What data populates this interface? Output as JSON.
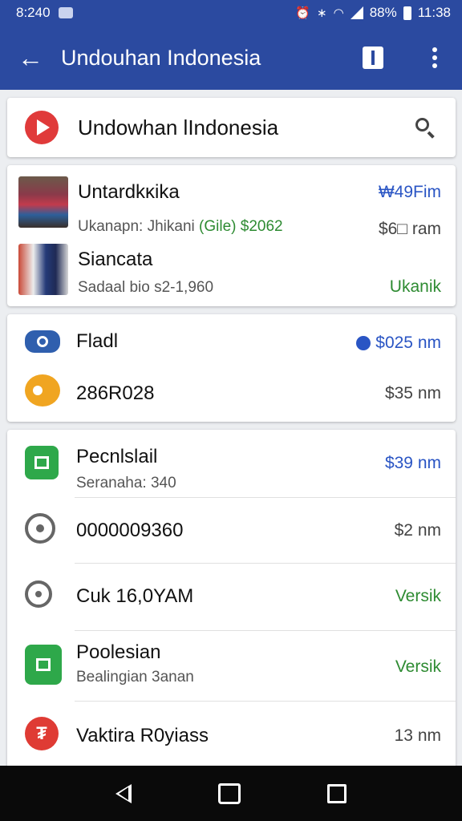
{
  "status_bar": {
    "time_left": "8:240",
    "battery_pct": "88%",
    "time_right": "11:38"
  },
  "app_bar": {
    "title": "Undouhan Indonesia"
  },
  "search": {
    "title": "Undowhan lIndonesia"
  },
  "group1": [
    {
      "title": "Untardkĸika",
      "subtitle": "Ukanapn: Jhikani",
      "tag": "(Gile)",
      "tag_amount": "$2062",
      "value_top": "₩49Fim",
      "value_bottom": "$6□ ram"
    },
    {
      "title": "Siancata",
      "subtitle": "Sadaal bio s2-1,960",
      "value": "Ukanik"
    }
  ],
  "group2": [
    {
      "title": "Fladl",
      "value": "$025 nm"
    },
    {
      "title": "286R028",
      "value": "$35 nm"
    }
  ],
  "group3": [
    {
      "title": "Pecnlslail",
      "subtitle": "Seranaha: 340",
      "value": "$39 nm"
    },
    {
      "title": "0000009360",
      "value": "$2 nm"
    },
    {
      "title": "Cuk 16,0YAM",
      "value": "Versik"
    },
    {
      "title": "Poolesian",
      "subtitle": "Bealingian 3anan",
      "value": "Versik"
    },
    {
      "title": "Vaktira R0yiass",
      "value": "13 nm"
    }
  ],
  "colors": {
    "appbar": "#2b4aa0",
    "accent_blue": "#2a55c4",
    "accent_green": "#2e8b32",
    "red": "#df3b34"
  }
}
